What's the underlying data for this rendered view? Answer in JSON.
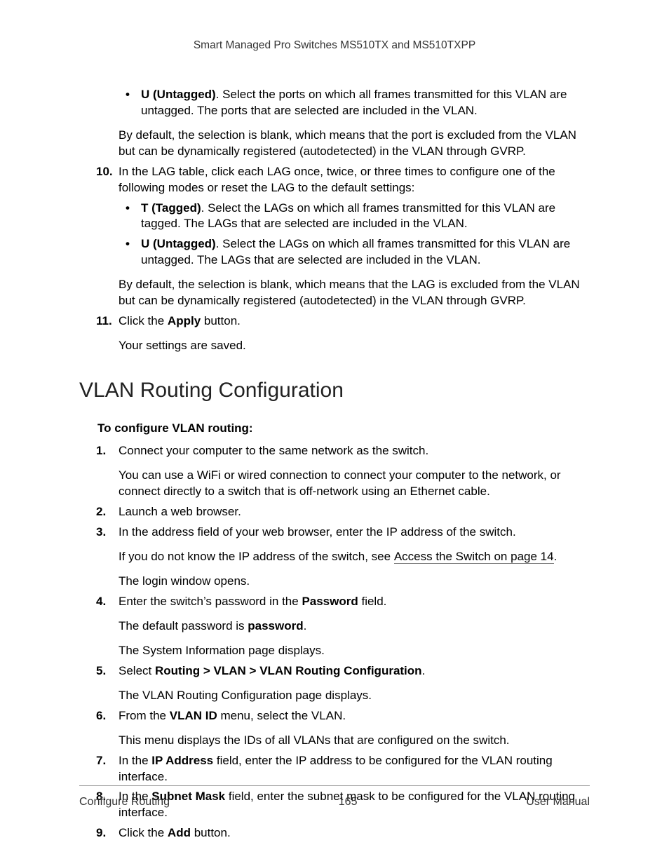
{
  "header": "Smart Managed Pro Switches MS510TX and MS510TXPP",
  "s1": {
    "b9_bullet_u_label": "U (Untagged)",
    "b9_bullet_u_text": ". Select the ports on which all frames transmitted for this VLAN are untagged. The ports that are selected are included in the VLAN.",
    "b9_default": "By default, the selection is blank, which means that the port is excluded from the VLAN but can be dynamically registered (autodetected) in the VLAN through GVRP.",
    "n10_marker": "10.",
    "n10_text": "In the LAG table, click each LAG once, twice, or three times to configure one of the following modes or reset the LAG to the default settings:",
    "n10_t_label": "T (Tagged)",
    "n10_t_text": ". Select the LAGs on which all frames transmitted for this VLAN are tagged. The LAGs that are selected are included in the VLAN.",
    "n10_u_label": "U (Untagged)",
    "n10_u_text": ". Select the LAGs on which all frames transmitted for this VLAN are untagged. The LAGs that are selected are included in the VLAN.",
    "n10_default": "By default, the selection is blank, which means that the LAG is excluded from the VLAN but can be dynamically registered (autodetected) in the VLAN through GVRP.",
    "n11_marker": "11.",
    "n11_pre": "Click the ",
    "n11_bold": "Apply",
    "n11_post": " button.",
    "n11_follow": "Your settings are saved."
  },
  "h2": "VLAN Routing Configuration",
  "subhead": "To configure VLAN routing:",
  "s2": {
    "n1_marker": "1.",
    "n1_text": "Connect your computer to the same network as the switch.",
    "n1_follow": "You can use a WiFi or wired connection to connect your computer to the network, or connect directly to a switch that is off-network using an Ethernet cable.",
    "n2_marker": "2.",
    "n2_text": "Launch a web browser.",
    "n3_marker": "3.",
    "n3_text": "In the address field of your web browser, enter the IP address of the switch.",
    "n3_follow_pre": "If you do not know the IP address of the switch, see ",
    "n3_link": "Access the Switch on page 14",
    "n3_follow_post": ".",
    "n3_follow2": "The login window opens.",
    "n4_marker": "4.",
    "n4_pre": "Enter the switch’s password in the ",
    "n4_bold": "Password",
    "n4_post": " field.",
    "n4_follow_pre": "The default password is ",
    "n4_follow_bold": "password",
    "n4_follow_post": ".",
    "n4_follow2": "The System Information page displays.",
    "n5_marker": "5.",
    "n5_pre": "Select ",
    "n5_bold": "Routing > VLAN > VLAN Routing Configuration",
    "n5_post": ".",
    "n5_follow": "The VLAN Routing Configuration page displays.",
    "n6_marker": "6.",
    "n6_pre": "From the ",
    "n6_bold": "VLAN ID",
    "n6_post": " menu, select the VLAN.",
    "n6_follow": "This menu displays the IDs of all VLANs that are configured on the switch.",
    "n7_marker": "7.",
    "n7_pre": "In the ",
    "n7_bold": "IP Address",
    "n7_post": " field, enter the IP address to be configured for the VLAN routing interface.",
    "n8_marker": "8.",
    "n8_pre": "In the ",
    "n8_bold": "Subnet Mask",
    "n8_post": " field, enter the subnet mask to be configured for the VLAN routing interface.",
    "n9_marker": "9.",
    "n9_pre": "Click the ",
    "n9_bold": "Add",
    "n9_post": " button."
  },
  "footer": {
    "left": "Configure Routing",
    "center": "165",
    "right": "User Manual"
  }
}
